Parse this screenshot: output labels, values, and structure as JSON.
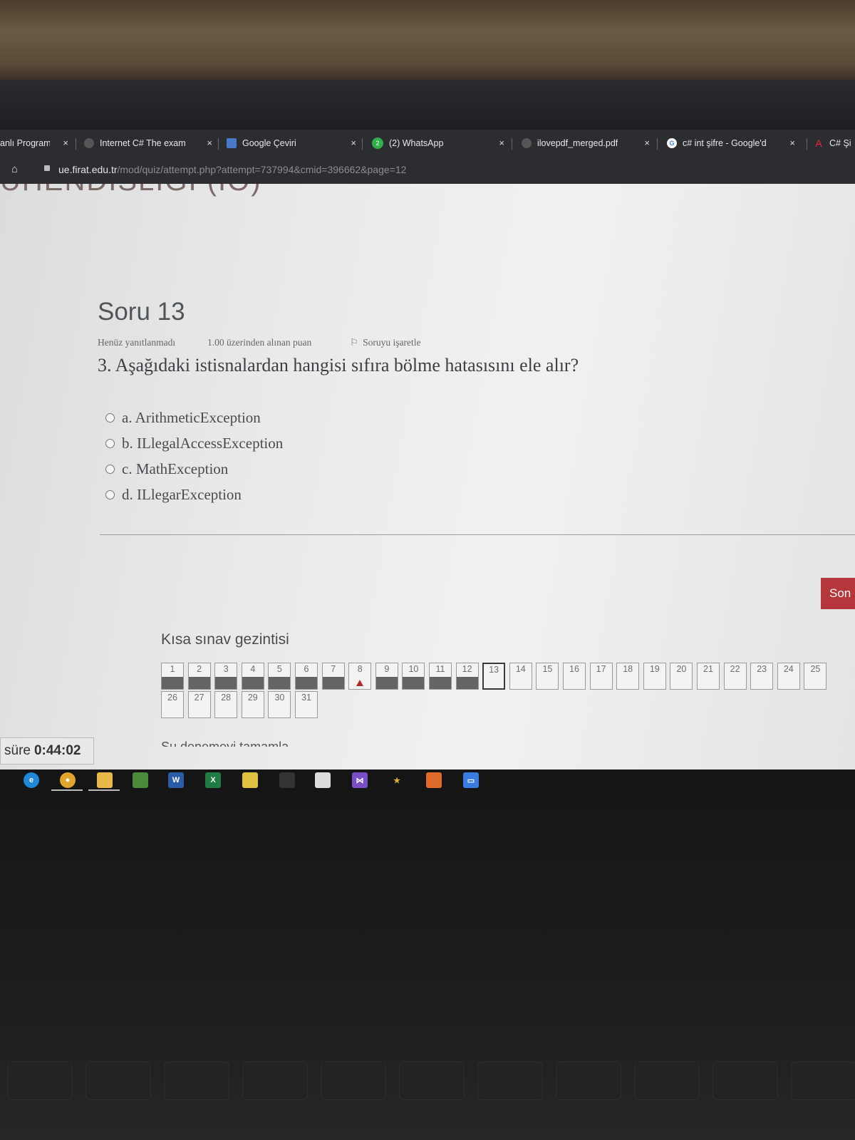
{
  "browser": {
    "tabs": [
      {
        "title": "anlı Program",
        "close": "×"
      },
      {
        "title": "Internet C# The exam",
        "close": "×"
      },
      {
        "title": "Google Çeviri",
        "close": "×"
      },
      {
        "title": "(2) WhatsApp",
        "badge": "2",
        "close": "×"
      },
      {
        "title": "ilovepdf_merged.pdf",
        "close": "×"
      },
      {
        "title": "c# int şifre - Google'd",
        "close": "×"
      },
      {
        "title": "C# Şi"
      }
    ],
    "address": {
      "host": "ue.firat.edu.tr",
      "path": "/mod/quiz/attempt.php?attempt=737994&cmid=396662&page=12"
    }
  },
  "page": {
    "header_fragment": "UHENDISLIGI (IÖ)",
    "question_title": "Soru 13",
    "status": "Henüz yanıtlanmadı",
    "points": "1.00 üzerinden alınan puan",
    "flag_label": "Soruyu işaretle",
    "question_text": "3. Aşağıdaki istisnalardan hangisi sıfıra bölme hatasısını ele alır?",
    "options": [
      "a. ArithmeticException",
      "b. ILlegalAccessException",
      "c. MathException",
      "d. ILlegarException"
    ],
    "next_button": "Son",
    "navigation": {
      "title": "Kısa sınav gezintisi",
      "row1": [
        "1",
        "2",
        "3",
        "4",
        "5",
        "6",
        "7",
        "8",
        "9",
        "10",
        "11",
        "12",
        "13",
        "14",
        "15",
        "16",
        "17",
        "18",
        "19",
        "20",
        "21",
        "22",
        "23",
        "24",
        "25"
      ],
      "row2": [
        "26",
        "27",
        "28",
        "29",
        "30",
        "31"
      ],
      "answered": [
        "1",
        "2",
        "3",
        "4",
        "5",
        "6",
        "7",
        "9",
        "10",
        "11",
        "12"
      ],
      "flagged": [
        "8"
      ],
      "current": "13"
    },
    "cut_text": "Su denemeyi tamamla"
  },
  "timer": {
    "label": "süre",
    "value": "0:44:02"
  },
  "taskbar_icons": [
    "edge-icon",
    "chrome-icon",
    "explorer-icon",
    "library-icon",
    "word-icon",
    "excel-icon",
    "notes-icon",
    "terminal-icon",
    "box-icon",
    "visual-studio-icon",
    "star-icon",
    "app-icon",
    "zoom-icon"
  ],
  "colors": {
    "accent_button": "#b5373b",
    "flag_marker": "#b22b2b",
    "answered_fill": "#626466"
  }
}
